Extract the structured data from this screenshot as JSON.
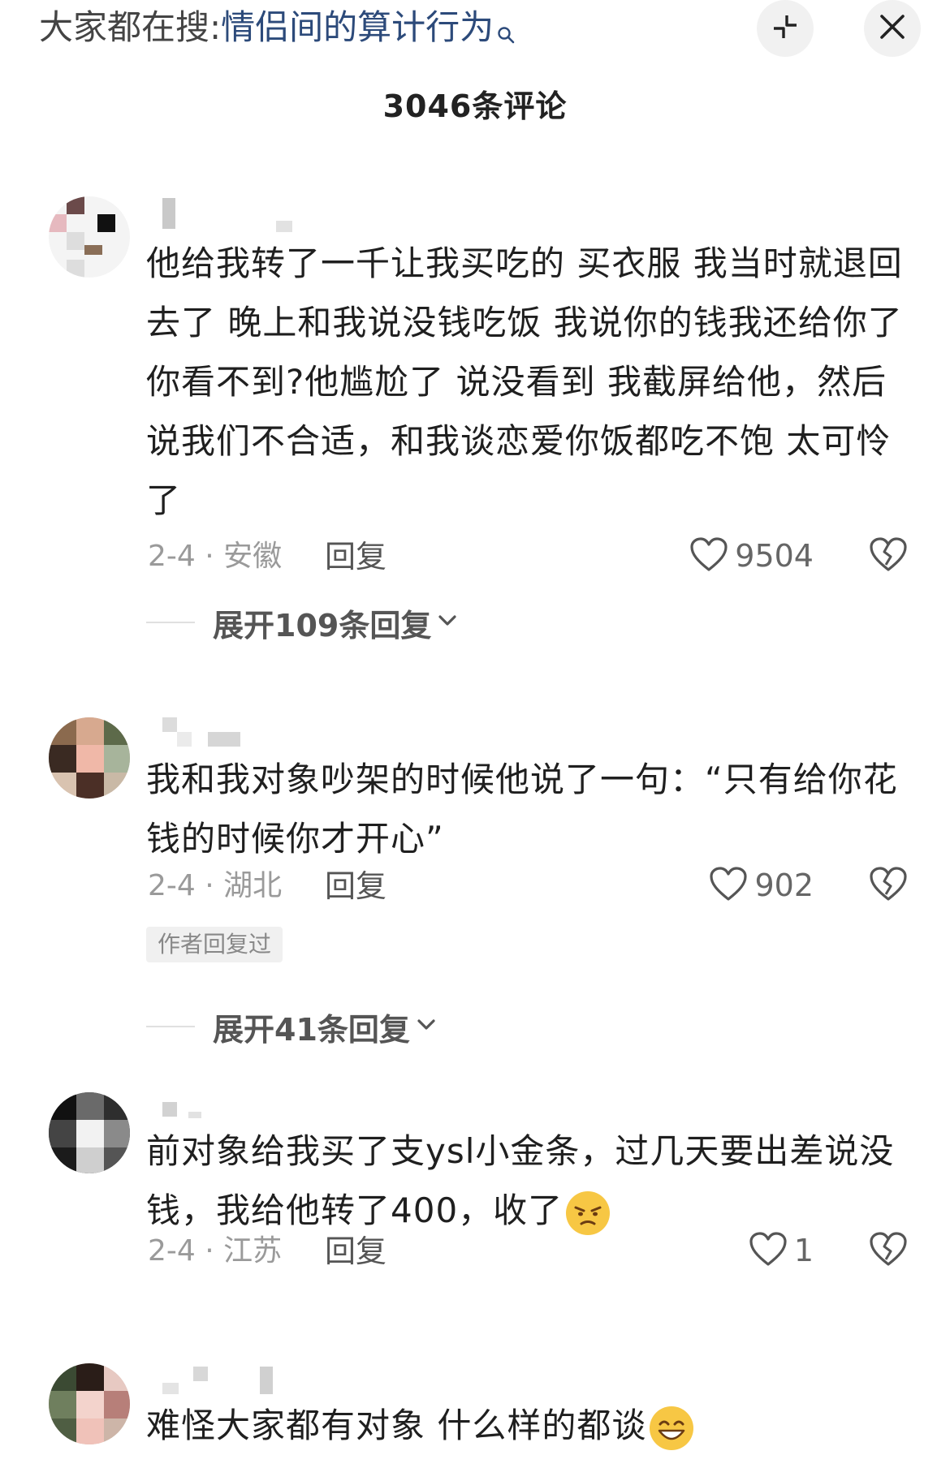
{
  "header": {
    "search_prefix": "大家都在搜:",
    "search_term": "情侣间的算计行为",
    "comment_count": "3046条评论"
  },
  "colors": {
    "search_term": "#2c4a7a",
    "meta_text": "#9a9a9a",
    "emoji_yellow": "#f7c744"
  },
  "icons": {
    "search": "search-icon",
    "collapse": "collapse-icon",
    "close": "close-icon",
    "like": "heart-icon",
    "dislike": "broken-heart-icon",
    "expand": "chevron-down-icon"
  },
  "comments": [
    {
      "text": "他给我转了一千让我买吃的  买衣服  我当时就退回去了  晚上和我说没钱吃饭  我说你的钱我还给你了  你看不到?他尴尬了  说没看到 我截屏给他，然后说我们不合适，和我谈恋爱你饭都吃不饱  太可怜了",
      "meta": "2-4 · 安徽",
      "reply_label": "回复",
      "likes": "9504",
      "expand_label": "展开109条回复"
    },
    {
      "text": "我和我对象吵架的时候他说了一句：“只有给你花钱的时候你才开心”",
      "meta": "2-4 · 湖北",
      "reply_label": "回复",
      "likes": "902",
      "author_badge": "作者回复过",
      "expand_label": "展开41条回复"
    },
    {
      "text": "前对象给我买了支ysl小金条，过几天要出差说没钱，我给他转了400，收了",
      "meta": "2-4 · 江苏",
      "reply_label": "回复",
      "likes": "1"
    },
    {
      "text": "难怪大家都有对象 什么样的都谈"
    }
  ]
}
